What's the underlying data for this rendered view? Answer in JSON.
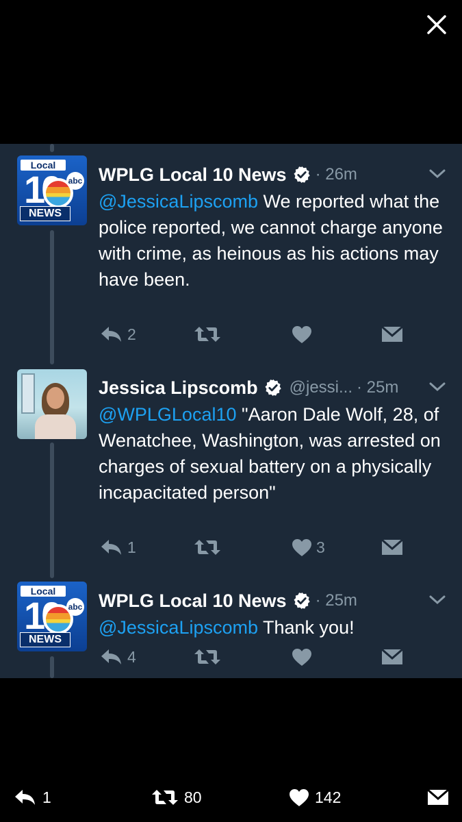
{
  "colors": {
    "mention": "#1da1f2",
    "muted": "#8899a6",
    "card_bg": "#1c2938",
    "page_bg": "#000000"
  },
  "icons": {
    "close": "close-icon",
    "verified": "verified-badge-icon",
    "caret": "chevron-down-icon",
    "reply": "reply-icon",
    "retweet": "retweet-icon",
    "like": "heart-icon",
    "dm": "envelope-icon"
  },
  "tweets": [
    {
      "avatar_logo": {
        "top": "Local",
        "number": "10",
        "network": "abc",
        "bottom": "NEWS"
      },
      "name": "WPLG Local 10 News",
      "time": "· 26m",
      "mention": "@JessicaLipscomb",
      "text": " We reported what the police reported, we cannot charge anyone with crime, as heinous as his actions may have been.",
      "replies": "2",
      "retweets": "",
      "likes": ""
    },
    {
      "name": "Jessica Lipscomb",
      "handle": "@jessi...",
      "time": "· 25m",
      "mention": "@WPLGLocal10",
      "text": " \"Aaron Dale Wolf, 28, of Wenatchee, Washington, was arrested on charges of sexual battery on a physically incapacitated person\"",
      "replies": "1",
      "retweets": "",
      "likes": "3"
    },
    {
      "avatar_logo": {
        "top": "Local",
        "number": "10",
        "network": "abc",
        "bottom": "NEWS"
      },
      "name": "WPLG Local 10 News",
      "time": "· 25m",
      "mention": "@JessicaLipscomb",
      "text": " Thank you!",
      "replies": "4",
      "retweets": "",
      "likes": ""
    }
  ],
  "bottom_bar": {
    "replies": "1",
    "retweets": "80",
    "likes": "142"
  }
}
